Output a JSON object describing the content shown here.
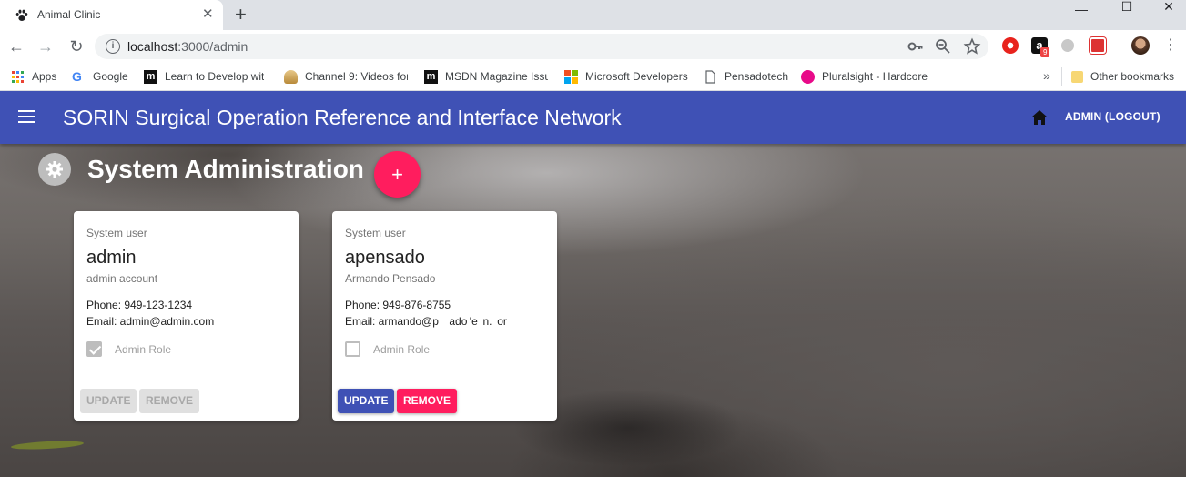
{
  "browser": {
    "tab": {
      "title": "Animal Clinic",
      "close": "✕"
    },
    "new_tab": "+",
    "window_controls": {
      "minimize": "—",
      "maximize": "☐",
      "close": "✕"
    },
    "nav": {
      "back": "←",
      "forward": "→",
      "reload": "↻"
    },
    "url": {
      "host": "localhost",
      "path": ":3000/admin"
    },
    "bookmarks": [
      {
        "label": "Apps",
        "icon": "apps-grid-icon"
      },
      {
        "label": "Google",
        "icon": "google-icon"
      },
      {
        "label": "Learn to Develop wit",
        "icon": "m-icon"
      },
      {
        "label": "Channel 9: Videos for",
        "icon": "channel9-icon"
      },
      {
        "label": "MSDN Magazine Issu",
        "icon": "m-icon"
      },
      {
        "label": "Microsoft Developers",
        "icon": "microsoft-icon"
      },
      {
        "label": "Pensadotech",
        "icon": "page-icon"
      },
      {
        "label": "Pluralsight - Hardcore",
        "icon": "pluralsight-icon"
      }
    ],
    "bookmarks_overflow": "»",
    "other_bookmarks": "Other bookmarks",
    "extension_badge": "9"
  },
  "appbar": {
    "title": "SORIN Surgical Operation Reference and Interface Network",
    "logout_label": "ADMIN (LOGOUT)"
  },
  "page": {
    "title": "System Administration",
    "add_label": "+"
  },
  "users": [
    {
      "kicker": "System user",
      "name": "admin",
      "subtitle": "admin account",
      "phone": "Phone: 949-123-1234",
      "email": "Email: admin@admin.com",
      "admin_role_label": "Admin Role",
      "admin_role_checked": true,
      "update_label": "UPDATE",
      "remove_label": "REMOVE",
      "buttons_enabled": false
    },
    {
      "kicker": "System user",
      "name": "apensado",
      "subtitle": "Armando Pensado",
      "phone": "Phone: 949-876-8755",
      "email": "Email: armando@p    ado 'e  n.  or  ",
      "admin_role_label": "Admin Role",
      "admin_role_checked": false,
      "update_label": "UPDATE",
      "remove_label": "REMOVE",
      "buttons_enabled": true
    }
  ],
  "colors": {
    "primary": "#3f51b5",
    "accent": "#ff1d5e",
    "disabled": "#e0e0e0"
  }
}
